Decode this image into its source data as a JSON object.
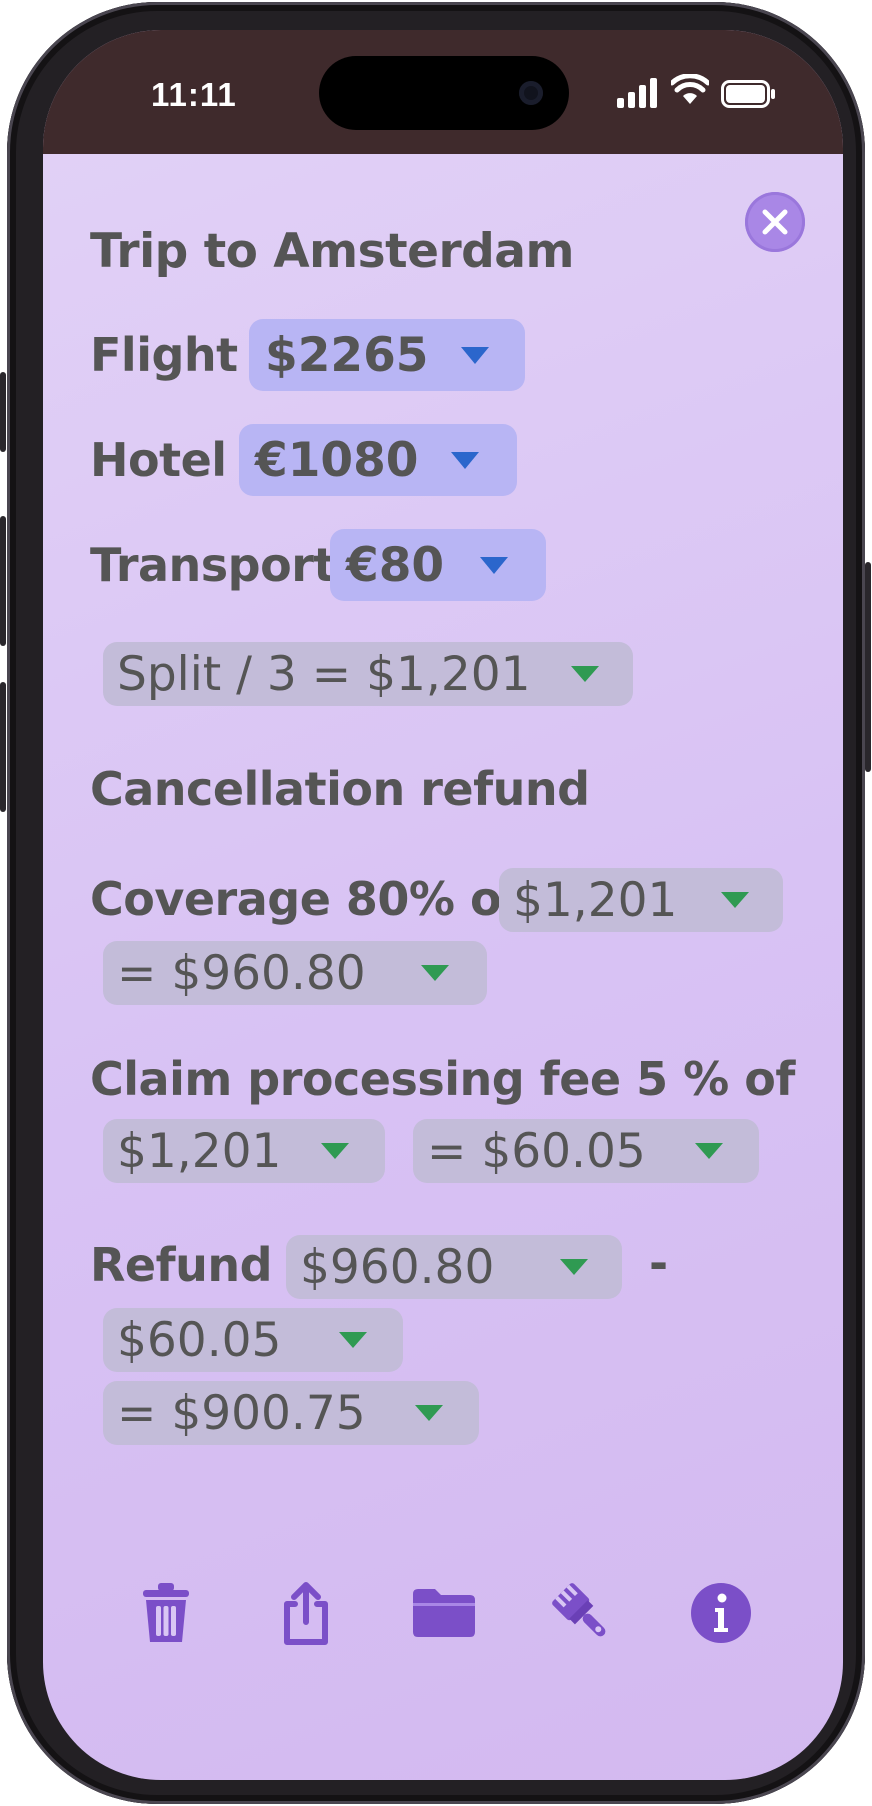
{
  "status_bar": {
    "time": "11:11"
  },
  "title": "Trip to Amsterdam",
  "rows": {
    "flight": {
      "label": "Flight",
      "value": "$2265"
    },
    "hotel": {
      "label": "Hotel",
      "value": "€1080"
    },
    "transport": {
      "label": "Transport",
      "value": "€80"
    }
  },
  "split": {
    "text": "Split / 3 = $1,201"
  },
  "cancellation": {
    "heading": "Cancellation refund",
    "coverage_label": "Coverage 80% of",
    "coverage_base": "$1,201",
    "coverage_result": "= $960.80",
    "fee_label": "Claim processing fee 5 %  of",
    "fee_base": "$1,201",
    "fee_result": "= $60.05",
    "refund_label": "Refund",
    "refund_a": "$960.80",
    "refund_minus": "-",
    "refund_b": "$60.05",
    "refund_result": "= $900.75"
  },
  "toolbar": {
    "icons": [
      "trash-icon",
      "share-icon",
      "folder-icon",
      "paintbrush-icon",
      "info-icon"
    ]
  },
  "colors": {
    "accent": "#7b4fc8",
    "screen_bg": "#dcc8f5",
    "chip_blue": "#b8b5f4",
    "chip_gray": "#c3bcd9",
    "dropdown_blue": "#2b66cc",
    "dropdown_green": "#2f9a52",
    "status_bar": "#3f2a2c"
  }
}
